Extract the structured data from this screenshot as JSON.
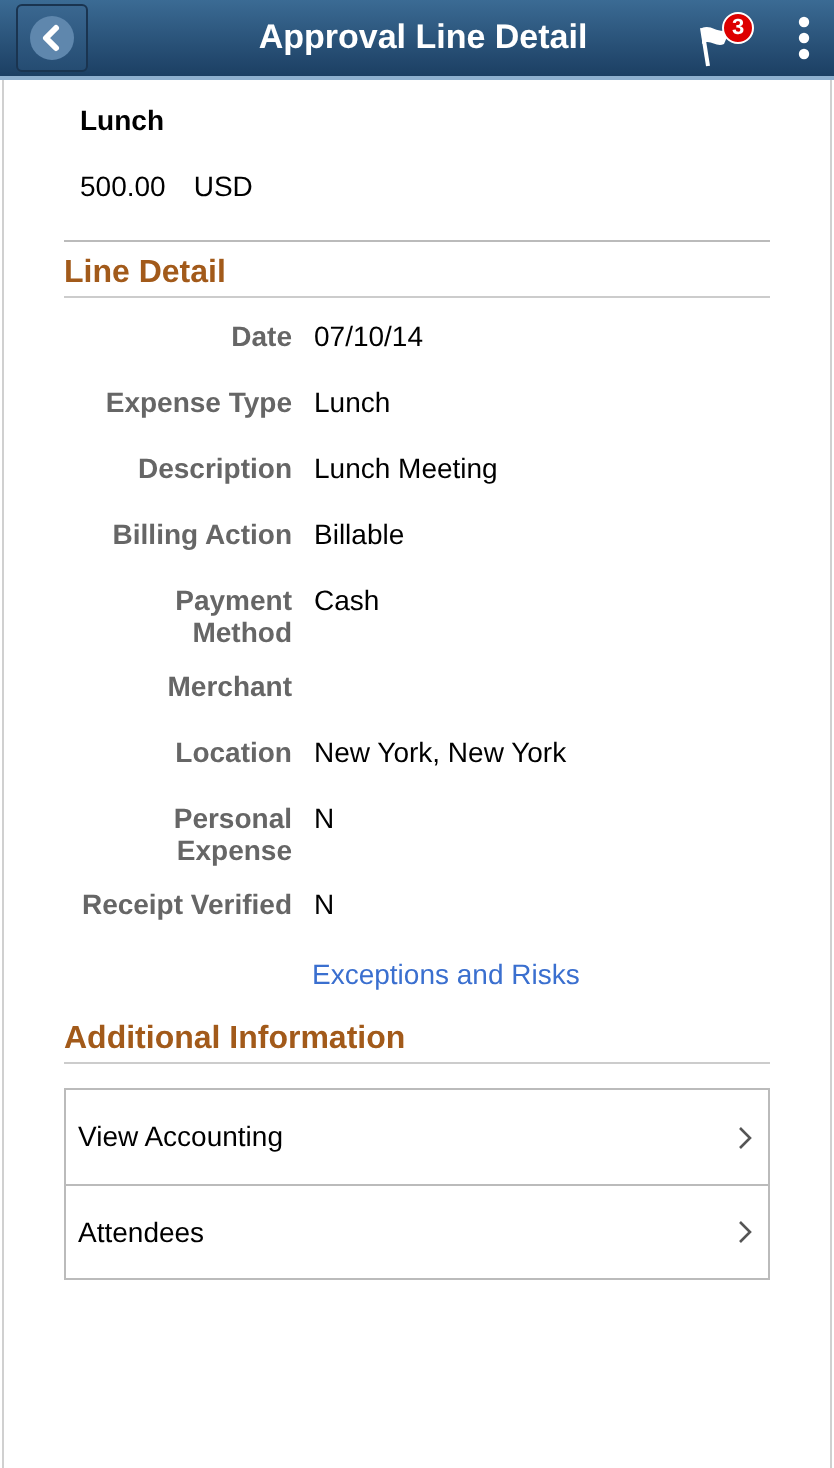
{
  "header": {
    "title": "Approval Line Detail",
    "notification_count": "3"
  },
  "summary": {
    "title": "Lunch",
    "amount": "500.00",
    "currency": "USD"
  },
  "line_detail": {
    "heading": "Line Detail",
    "fields": [
      {
        "label": "Date",
        "value": "07/10/14"
      },
      {
        "label": "Expense Type",
        "value": "Lunch"
      },
      {
        "label": "Description",
        "value": "Lunch Meeting"
      },
      {
        "label": "Billing Action",
        "value": "Billable"
      },
      {
        "label": "Payment Method",
        "value": "Cash"
      },
      {
        "label": "Merchant"
      },
      {
        "label": "Location",
        "value": "New York, New York"
      },
      {
        "label": "Personal Expense",
        "value": "N"
      },
      {
        "label": "Receipt Verified",
        "value": "N"
      }
    ],
    "link": "Exceptions and Risks"
  },
  "additional_information": {
    "heading": "Additional Information",
    "items": [
      {
        "label": "View Accounting"
      },
      {
        "label": "Attendees"
      }
    ]
  }
}
